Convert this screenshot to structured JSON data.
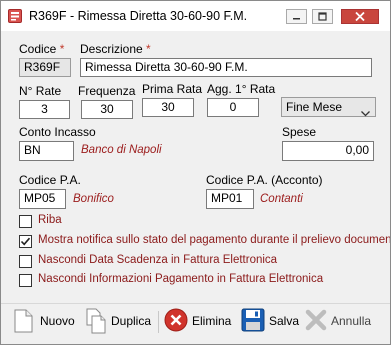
{
  "window": {
    "title": "R369F - Rimessa Diretta 30-60-90 F.M."
  },
  "form": {
    "codice": {
      "label": "Codice",
      "required_mark": "*",
      "value": "R369F"
    },
    "descrizione": {
      "label": "Descrizione",
      "required_mark": "*",
      "value": "Rimessa Diretta 30-60-90 F.M."
    },
    "n_rate": {
      "label": "N° Rate",
      "value": "3"
    },
    "frequenza": {
      "label": "Frequenza",
      "value": "30"
    },
    "prima_rata": {
      "label": "Prima Rata",
      "value": "30"
    },
    "agg_rata": {
      "label": "Agg. 1° Rata",
      "value": "0"
    },
    "fine_mese": {
      "value": "Fine Mese"
    },
    "conto_incasso": {
      "label": "Conto Incasso",
      "value": "BN",
      "hint": "Banco di Napoli"
    },
    "spese": {
      "label": "Spese",
      "value": "0,00"
    },
    "codice_pa": {
      "label": "Codice P.A.",
      "value": "MP05",
      "hint": "Bonifico"
    },
    "codice_pa_acconto": {
      "label": "Codice P.A. (Acconto)",
      "value": "MP01",
      "hint": "Contanti"
    },
    "checks": [
      {
        "label": "Riba",
        "checked": false
      },
      {
        "label": "Mostra notifica sullo stato del pagamento durante il prelievo documenti",
        "checked": true
      },
      {
        "label": "Nascondi Data Scadenza in Fattura Elettronica",
        "checked": false
      },
      {
        "label": "Nascondi Informazioni Pagamento in Fattura Elettronica",
        "checked": false
      }
    ]
  },
  "toolbar": {
    "nuovo": "Nuovo",
    "duplica": "Duplica",
    "elimina": "Elimina",
    "salva": "Salva",
    "annulla": "Annulla"
  },
  "colors": {
    "accent_red": "#c0392b",
    "hint_red": "#9b1b1b",
    "save_blue": "#1a5fb4"
  }
}
